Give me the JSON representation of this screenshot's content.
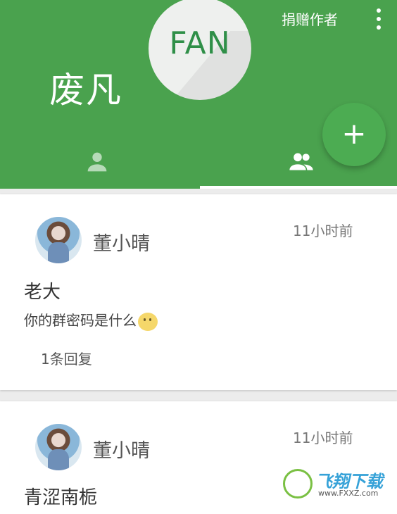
{
  "header": {
    "title": "废凡",
    "logo_text": "FAN",
    "donate_label": "捐赠作者",
    "colors": {
      "primary": "#4aa24e",
      "fab": "#4cac52"
    }
  },
  "tabs": [
    {
      "icon": "person-icon",
      "selected": false
    },
    {
      "icon": "group-icon",
      "selected": true
    }
  ],
  "fab": {
    "label": "+"
  },
  "posts": [
    {
      "author": "董小晴",
      "time": "11小时前",
      "title": "老大",
      "body": "你的群密码是什么",
      "emoji": "confused-face-icon",
      "replies": "1条回复"
    },
    {
      "author": "董小晴",
      "time": "11小时前",
      "title": "青涩南栀"
    }
  ],
  "watermark": {
    "main": "飞翔下载",
    "sub": "www.FXXZ.com"
  }
}
